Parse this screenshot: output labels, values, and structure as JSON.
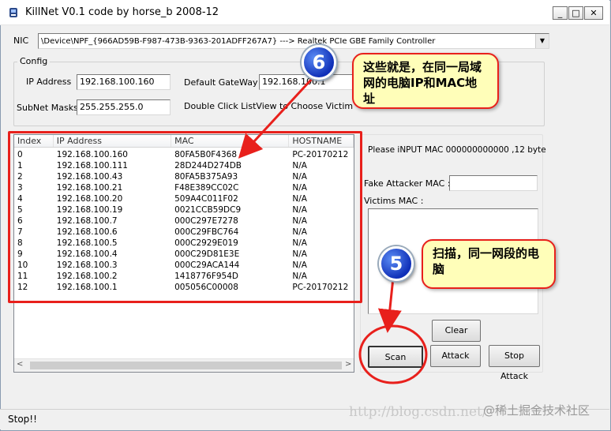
{
  "window": {
    "title": "KillNet  V0.1 code by horse_b 2008-12",
    "min_label": "_",
    "max_label": "□",
    "close_label": "✕"
  },
  "nic": {
    "label": "NIC",
    "value": "\\Device\\NPF_{966AD59B-F987-473B-9363-201ADFF267A7}  --->  Realtek PCIe GBE Family Controller",
    "arrow": "▼"
  },
  "config": {
    "title": "Config",
    "ip_label": "IP Address",
    "ip_value": "192.168.100.160",
    "gateway_label": "Default GateWay",
    "gateway_value": "192.168.100.1",
    "subnet_label": "SubNet Masks",
    "subnet_value": "255.255.255.0",
    "hint": "Double Click ListView to Choose Victim Machi"
  },
  "listview": {
    "columns": [
      "Index",
      "IP Address",
      "MAC",
      "HOSTNAME"
    ],
    "rows": [
      [
        "0",
        "192.168.100.160",
        "80FA5B0F4368",
        "PC-20170212"
      ],
      [
        "1",
        "192.168.100.111",
        "28D244D274DB",
        "N/A"
      ],
      [
        "2",
        "192.168.100.43",
        "80FA5B375A93",
        "N/A"
      ],
      [
        "3",
        "192.168.100.21",
        "F48E389CC02C",
        "N/A"
      ],
      [
        "4",
        "192.168.100.20",
        "509A4C011F02",
        "N/A"
      ],
      [
        "5",
        "192.168.100.19",
        "0021CCB59DC9",
        "N/A"
      ],
      [
        "6",
        "192.168.100.7",
        "000C297E7278",
        "N/A"
      ],
      [
        "7",
        "192.168.100.6",
        "000C29FBC764",
        "N/A"
      ],
      [
        "8",
        "192.168.100.5",
        "000C2929E019",
        "N/A"
      ],
      [
        "9",
        "192.168.100.4",
        "000C29D81E3E",
        "N/A"
      ],
      [
        "10",
        "192.168.100.3",
        "000C29ACA144",
        "N/A"
      ],
      [
        "11",
        "192.168.100.2",
        "1418776F954D",
        "N/A"
      ],
      [
        "12",
        "192.168.100.1",
        "005056C00008",
        "PC-20170212"
      ]
    ],
    "scroll_left": "<",
    "scroll_right": ">"
  },
  "right_panel": {
    "mac_hint": "Please iNPUT MAC 000000000000 ,12 byte",
    "fake_mac_label": "Fake Attacker MAC :",
    "fake_mac_value": "",
    "victims_label": "Victims MAC :"
  },
  "buttons": {
    "clear": "Clear",
    "scan": "Scan",
    "attack": "Attack",
    "stop_attack": "Stop Attack"
  },
  "status": {
    "text": "Stop!!"
  },
  "annotations": {
    "badge6": "6",
    "callout6": "这些就是，在同一局域网的电脑IP和MAC地址",
    "badge5": "5",
    "callout5": "扫描，同一网段的电脑"
  },
  "watermark": {
    "url": "http://blog.csdn.net/",
    "brand": "@稀土掘金技术社区"
  },
  "colors": {
    "annotation_red": "#e8201c",
    "callout_bg": "#fffeb9",
    "badge_blue": "#1030b8"
  }
}
